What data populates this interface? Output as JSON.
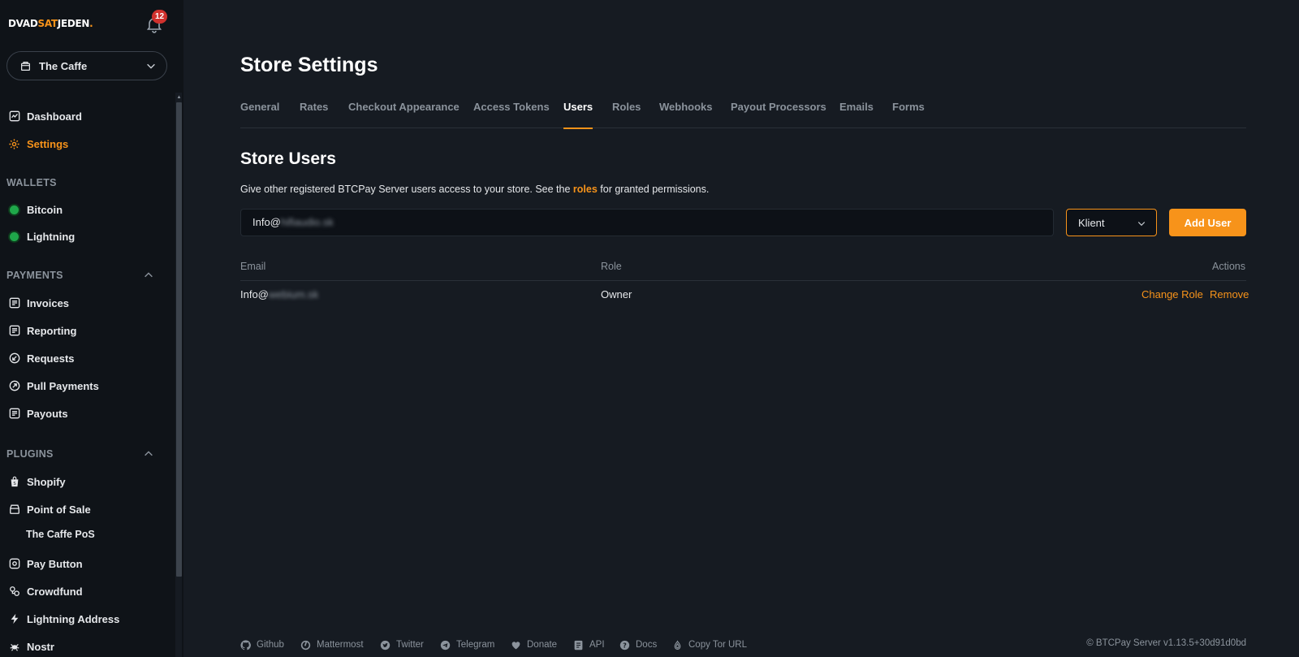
{
  "brand": {
    "part1": "DVAD",
    "part2": "SAT",
    "part3": "JEDEN",
    "dot": "."
  },
  "notifications": {
    "count": "12"
  },
  "store": {
    "name": "The Caffe"
  },
  "nav": {
    "dashboard": "Dashboard",
    "settings": "Settings",
    "wallets_header": "WALLETS",
    "bitcoin": "Bitcoin",
    "lightning": "Lightning",
    "payments_header": "PAYMENTS",
    "invoices": "Invoices",
    "reporting": "Reporting",
    "requests": "Requests",
    "pull_payments": "Pull Payments",
    "payouts": "Payouts",
    "plugins_header": "PLUGINS",
    "shopify": "Shopify",
    "point_of_sale": "Point of Sale",
    "pos_sub": "The Caffe PoS",
    "pay_button": "Pay Button",
    "crowdfund": "Crowdfund",
    "lightning_address": "Lightning Address",
    "nostr": "Nostr"
  },
  "page": {
    "title": "Store Settings"
  },
  "tabs": [
    {
      "label": "General"
    },
    {
      "label": "Rates"
    },
    {
      "label": "Checkout Appearance"
    },
    {
      "label": "Access Tokens"
    },
    {
      "label": "Users"
    },
    {
      "label": "Roles"
    },
    {
      "label": "Webhooks"
    },
    {
      "label": "Payout Processors"
    },
    {
      "label": "Emails"
    },
    {
      "label": "Forms"
    }
  ],
  "users": {
    "title": "Store Users",
    "desc_before": "Give other registered BTCPay Server users access to your store. See the ",
    "desc_link": "roles",
    "desc_after": " for granted permissions.",
    "email_value_prefix": "Info@",
    "email_value_blur": "hifiaudio.sk",
    "role_selected": "Klient",
    "add_button": "Add User",
    "columns": {
      "email": "Email",
      "role": "Role",
      "actions": "Actions"
    },
    "rows": [
      {
        "email_prefix": "Info@",
        "email_blur": "webium.sk",
        "role": "Owner",
        "change_role": "Change Role",
        "remove": "Remove"
      }
    ]
  },
  "footer": {
    "github": "Github",
    "mattermost": "Mattermost",
    "twitter": "Twitter",
    "telegram": "Telegram",
    "donate": "Donate",
    "api": "API",
    "docs": "Docs",
    "tor": "Copy Tor URL",
    "version": "© BTCPay Server v1.13.5+30d91d0bd"
  },
  "colors": {
    "accent": "#f7931a",
    "background": "#161b22",
    "sidebar": "#0f1318",
    "online": "#1fa84a",
    "badge": "#d0312d"
  }
}
